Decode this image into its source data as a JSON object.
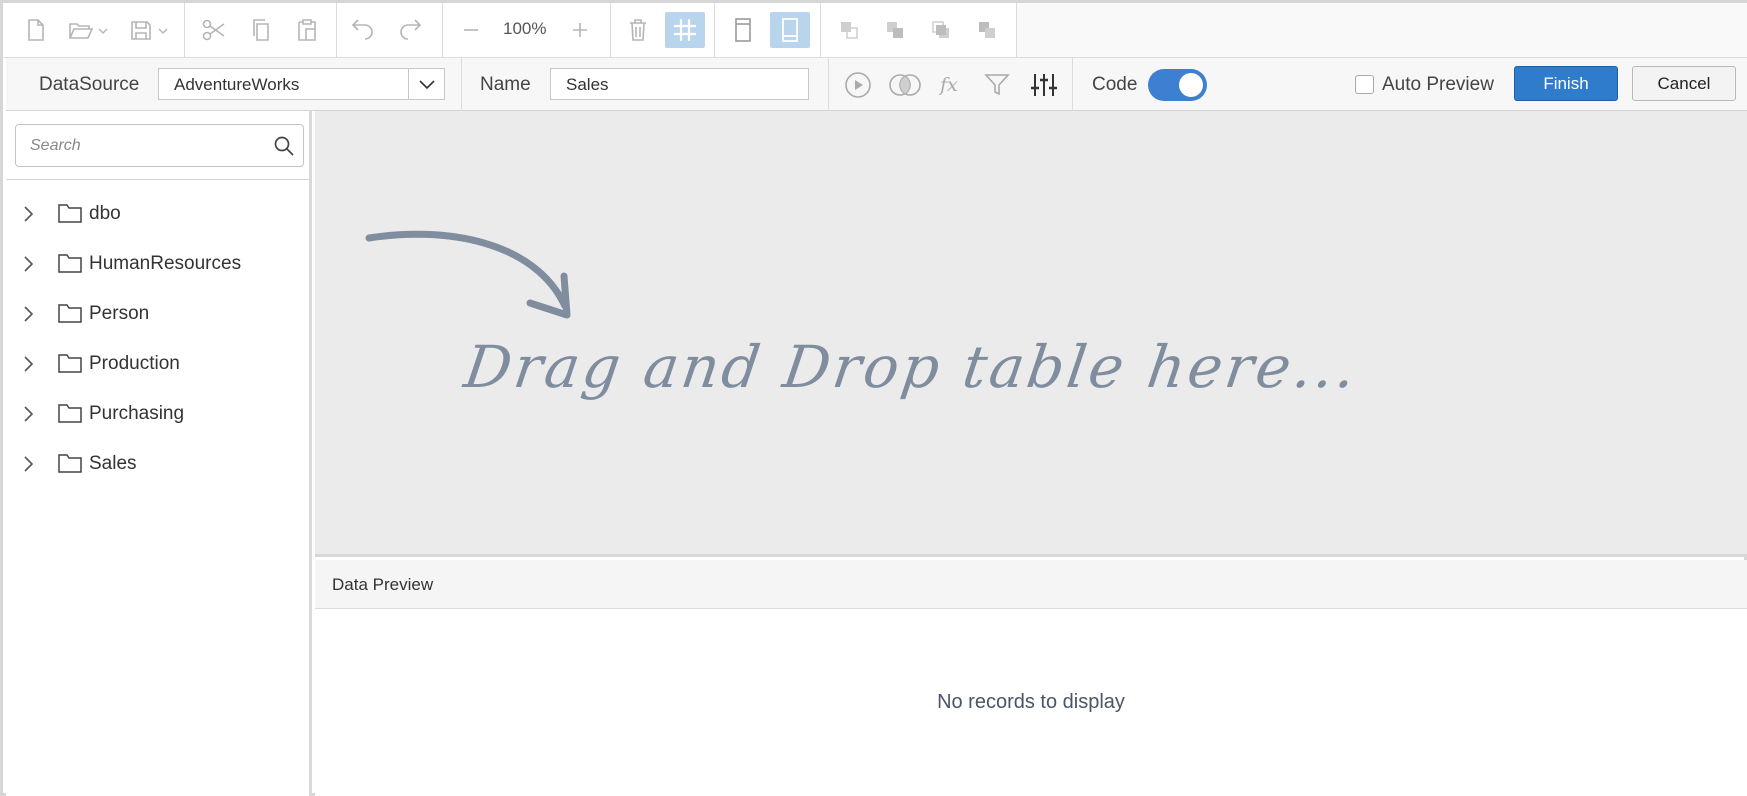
{
  "toolbar": {
    "zoom": "100%"
  },
  "propbar": {
    "datasource_label": "DataSource",
    "datasource_value": "AdventureWorks",
    "name_label": "Name",
    "name_value": "Sales",
    "code_label": "Code",
    "code_enabled": true,
    "auto_preview_label": "Auto Preview",
    "auto_preview_checked": false,
    "finish_label": "Finish",
    "cancel_label": "Cancel"
  },
  "sidebar": {
    "search_placeholder": "Search",
    "items": [
      {
        "label": "dbo"
      },
      {
        "label": "HumanResources"
      },
      {
        "label": "Person"
      },
      {
        "label": "Production"
      },
      {
        "label": "Purchasing"
      },
      {
        "label": "Sales"
      }
    ]
  },
  "canvas": {
    "drop_hint": "Drag and Drop table here..."
  },
  "preview": {
    "title": "Data Preview",
    "empty_message": "No records to display"
  },
  "colors": {
    "accent": "#2f7ccc",
    "active_tool": "#b9d5ee",
    "canvas_bg": "#ebebeb",
    "hint_text": "#7f8d9f"
  }
}
